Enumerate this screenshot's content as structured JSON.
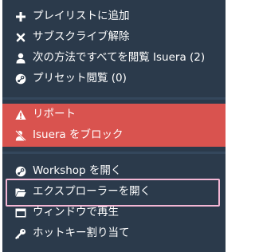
{
  "menu": {
    "top_items": [
      {
        "label": "プレイリストに追加",
        "icon": "plus-icon"
      },
      {
        "label": "サブスクライブ解除",
        "icon": "close-icon"
      },
      {
        "label": "次の方法ですべてを閲覧 Isuera (2)",
        "icon": "user-icon"
      },
      {
        "label": "プリセット閲覧 (0)",
        "icon": "steam-icon"
      }
    ],
    "danger_items": [
      {
        "label": "リポート",
        "icon": "warning-icon"
      },
      {
        "label": "Isuera をブロック",
        "icon": "user-block-icon"
      }
    ],
    "bottom_items": [
      {
        "label": "Workshop を開く",
        "icon": "steam-icon"
      },
      {
        "label": "エクスプローラーを開く",
        "icon": "folder-open-icon"
      },
      {
        "label": "ウィンドウで再生",
        "icon": "window-icon"
      },
      {
        "label": "ホットキー割り当て",
        "icon": "key-icon"
      }
    ]
  },
  "colors": {
    "menu_bg": "#2b3a4b",
    "danger_bg": "#d9534f",
    "highlight_border": "#f3b6d4",
    "text": "#ffffff"
  }
}
